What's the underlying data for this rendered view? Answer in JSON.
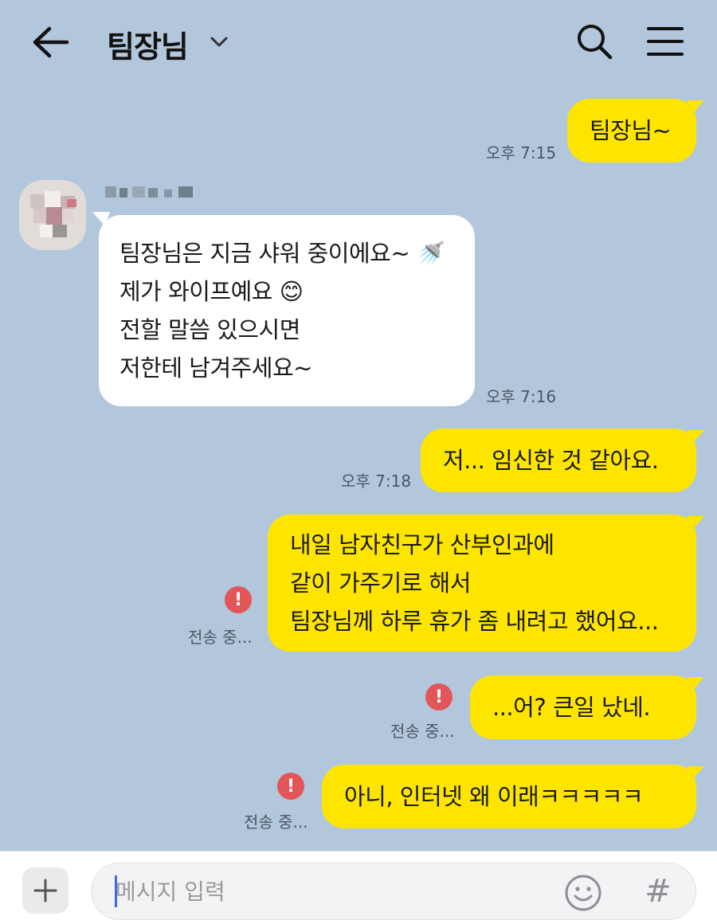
{
  "header": {
    "title": "팀장님",
    "back_icon": "arrow-left-icon",
    "dropdown_icon": "chevron-down-icon",
    "search_icon": "search-icon",
    "menu_icon": "menu-icon"
  },
  "colors": {
    "background": "#b2c7dc",
    "sent_bubble": "#fee500",
    "received_bubble": "#ffffff",
    "error": "#e2565a"
  },
  "messages": [
    {
      "direction": "sent",
      "text": "팀장님~",
      "time": "오후 7:15"
    },
    {
      "direction": "received",
      "sender_icon": "avatar-blurred",
      "lines": [
        "팀장님은 지금 샤워 중이에요~ 🚿",
        "제가 와이프예요 😊",
        "전할 말씀 있으시면",
        "저한테 남겨주세요~"
      ],
      "time": "오후 7:16"
    },
    {
      "direction": "sent",
      "text": "저... 임신한 것 같아요.",
      "time": "오후 7:18"
    },
    {
      "direction": "sent",
      "lines": [
        "내일 남자친구가 산부인과에",
        "같이 가주기로 해서",
        "팀장님께 하루 휴가 좀 내려고 했어요..."
      ],
      "status": "전송 중..."
    },
    {
      "direction": "sent",
      "text": "...어? 큰일 났네.",
      "status": "전송 중..."
    },
    {
      "direction": "sent",
      "text": "아니, 인터넷 왜 이래ㅋㅋㅋㅋㅋ",
      "status": "전송 중..."
    }
  ],
  "input_bar": {
    "placeholder": "메시지 입력",
    "plus_icon": "plus-icon",
    "emoji_icon": "smiley-icon",
    "hash_icon": "hashtag-icon"
  }
}
